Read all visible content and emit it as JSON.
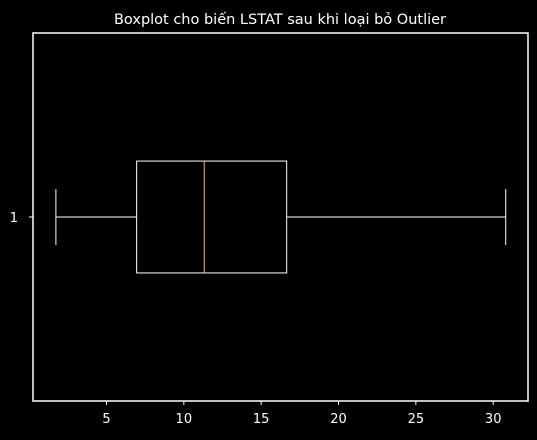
{
  "chart_data": {
    "type": "boxplot",
    "title": "Boxplot cho biến LSTAT sau khi loại bỏ Outlier",
    "orientation": "horizontal",
    "xlabel": "",
    "ylabel": "",
    "xlim": [
      0.25,
      32.25
    ],
    "xticks": [
      5,
      10,
      15,
      20,
      25,
      30
    ],
    "ytick_labels": [
      "1"
    ],
    "grid": false,
    "series": [
      {
        "category": "1",
        "whisker_low": 1.73,
        "q1": 6.95,
        "median": 11.32,
        "q3": 16.65,
        "whisker_high": 30.81
      }
    ],
    "colors": {
      "background": "#000000",
      "frame": "#ffffff",
      "box": "#ffffff",
      "median": "#f5c243",
      "text": "#ffffff"
    }
  }
}
